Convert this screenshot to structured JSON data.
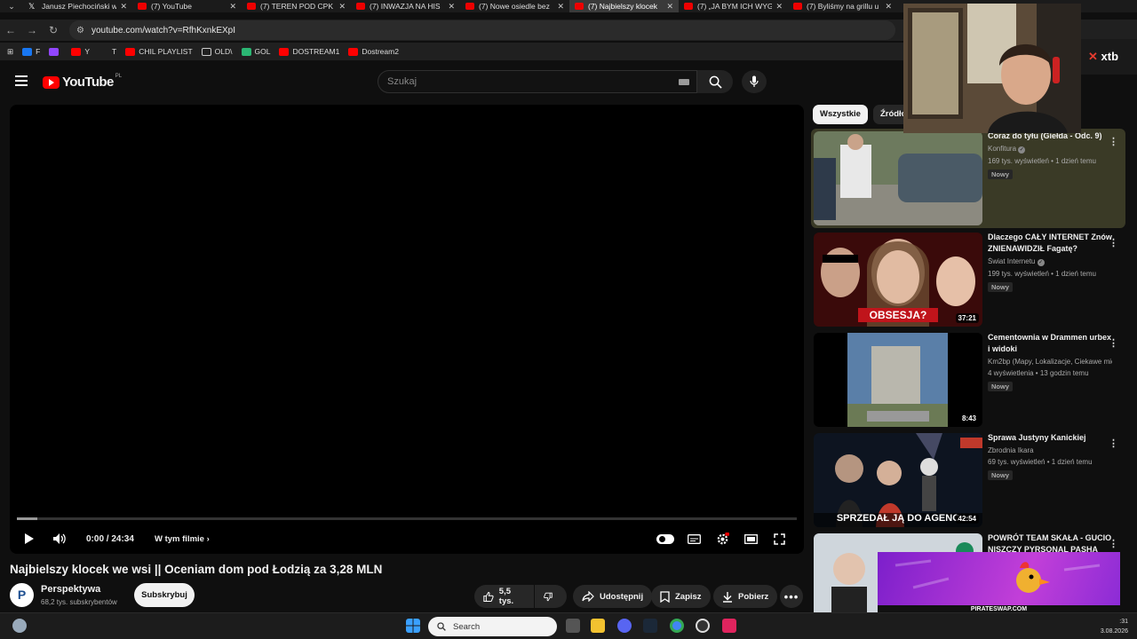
{
  "tabs": [
    {
      "title": "Janusz Piechociński w",
      "icon": "x-icon",
      "active": false
    },
    {
      "title": "(7) YouTube",
      "icon": "youtube-icon",
      "active": false
    },
    {
      "title": "(7) TEREN POD CPK /",
      "icon": "youtube-icon",
      "active": false
    },
    {
      "title": "(7) INWAZJA NA HIS",
      "icon": "youtube-icon",
      "active": false
    },
    {
      "title": "(7) Nowe osiedle bez",
      "icon": "youtube-icon",
      "active": false
    },
    {
      "title": "(7) Najbielszy klocek",
      "icon": "youtube-icon",
      "active": true
    },
    {
      "title": "(7) „JA BYM ICH WYG",
      "icon": "youtube-icon",
      "active": false
    },
    {
      "title": "(7) Byliśmy na grillu u",
      "icon": "youtube-icon",
      "active": false
    }
  ],
  "address": {
    "url": "youtube.com/watch?v=RfhKxnkEXpI"
  },
  "bookmarks": [
    {
      "label": "F",
      "color": "#1877f2"
    },
    {
      "label": "",
      "color": "#9146ff"
    },
    {
      "label": "Y",
      "color": "#ff0000"
    },
    {
      "label": "T",
      "color": "transparent"
    },
    {
      "label": "CHIL PLAYLIST",
      "color": "#ff0000"
    },
    {
      "label": "OLD\\",
      "color": "folder"
    },
    {
      "label": "GOL",
      "color": "#2bb673"
    },
    {
      "label": "DOSTREAM1",
      "color": "#ff0000"
    },
    {
      "label": "Dostream2",
      "color": "#ff0000"
    }
  ],
  "header": {
    "logo_text": "YouTube",
    "logo_country": "PL",
    "search_placeholder": "Szukaj"
  },
  "player": {
    "time": "0:00 / 24:34",
    "chapters_label": "W tym filmie",
    "progress": 0.0
  },
  "video": {
    "title": "Najbielszy klocek we wsi || Oceniam dom pod Łodzią za 3,28 MLN",
    "channel": "Perspektywa",
    "avatar_letter": "P",
    "subscribers": "68,2 tys. subskrybentów",
    "subscribe_label": "Subskrybuj",
    "likes": "5,5 tys.",
    "share_label": "Udostępnij",
    "save_label": "Zapisz",
    "download_label": "Pobierz"
  },
  "chips": [
    {
      "label": "Wszystkie",
      "active": true
    },
    {
      "label": "Źródło:",
      "active": false
    }
  ],
  "recommendations": [
    {
      "title": "Coraz do tyłu (Giełda - Odc. 9)",
      "channel": "Konfitura",
      "verified": true,
      "meta": "169 tys. wyświetleń • 1 dzień temu",
      "badge": "Nowy",
      "duration": "",
      "highlight": true
    },
    {
      "title": "Dlaczego CAŁY INTERNET Znów ZNIENAWIDZIŁ Fagatę?",
      "channel": "Świat Internetu",
      "verified": true,
      "meta": "199 tys. wyświetleń • 1 dzień temu",
      "badge": "Nowy",
      "duration": "37:21",
      "thumb_text": "OBSESJA?",
      "highlight": false
    },
    {
      "title": "Cementownia w Drammen urbex i widoki",
      "channel": "Km2bp (Mapy, Lokalizacje, Ciekawe miej...",
      "verified": false,
      "meta": "4 wyświetlenia • 13 godzin temu",
      "badge": "Nowy",
      "duration": "8:43",
      "highlight": false
    },
    {
      "title": "Sprawa Justyny Kanickiej",
      "channel": "Zbrodnia Ikara",
      "verified": false,
      "meta": "69 tys. wyświetleń • 1 dzień temu",
      "badge": "Nowy",
      "duration": "42:54",
      "thumb_text": "SPRZEDAŁ JĄ DO AGENC",
      "highlight": false
    },
    {
      "title": "POWRÓT TEAM SKAŁA - GUCIO NISZCZY PYRSONAL PASHA",
      "channel": "",
      "verified": false,
      "meta": "",
      "badge": "",
      "duration": "",
      "highlight": false
    }
  ],
  "overlay": {
    "text": "PIRATESWAP.COM"
  },
  "xtb": {
    "brand": "xtb"
  },
  "taskbar": {
    "search_label": "Search",
    "clock_time": ":31",
    "clock_date": "3.08.2026"
  }
}
